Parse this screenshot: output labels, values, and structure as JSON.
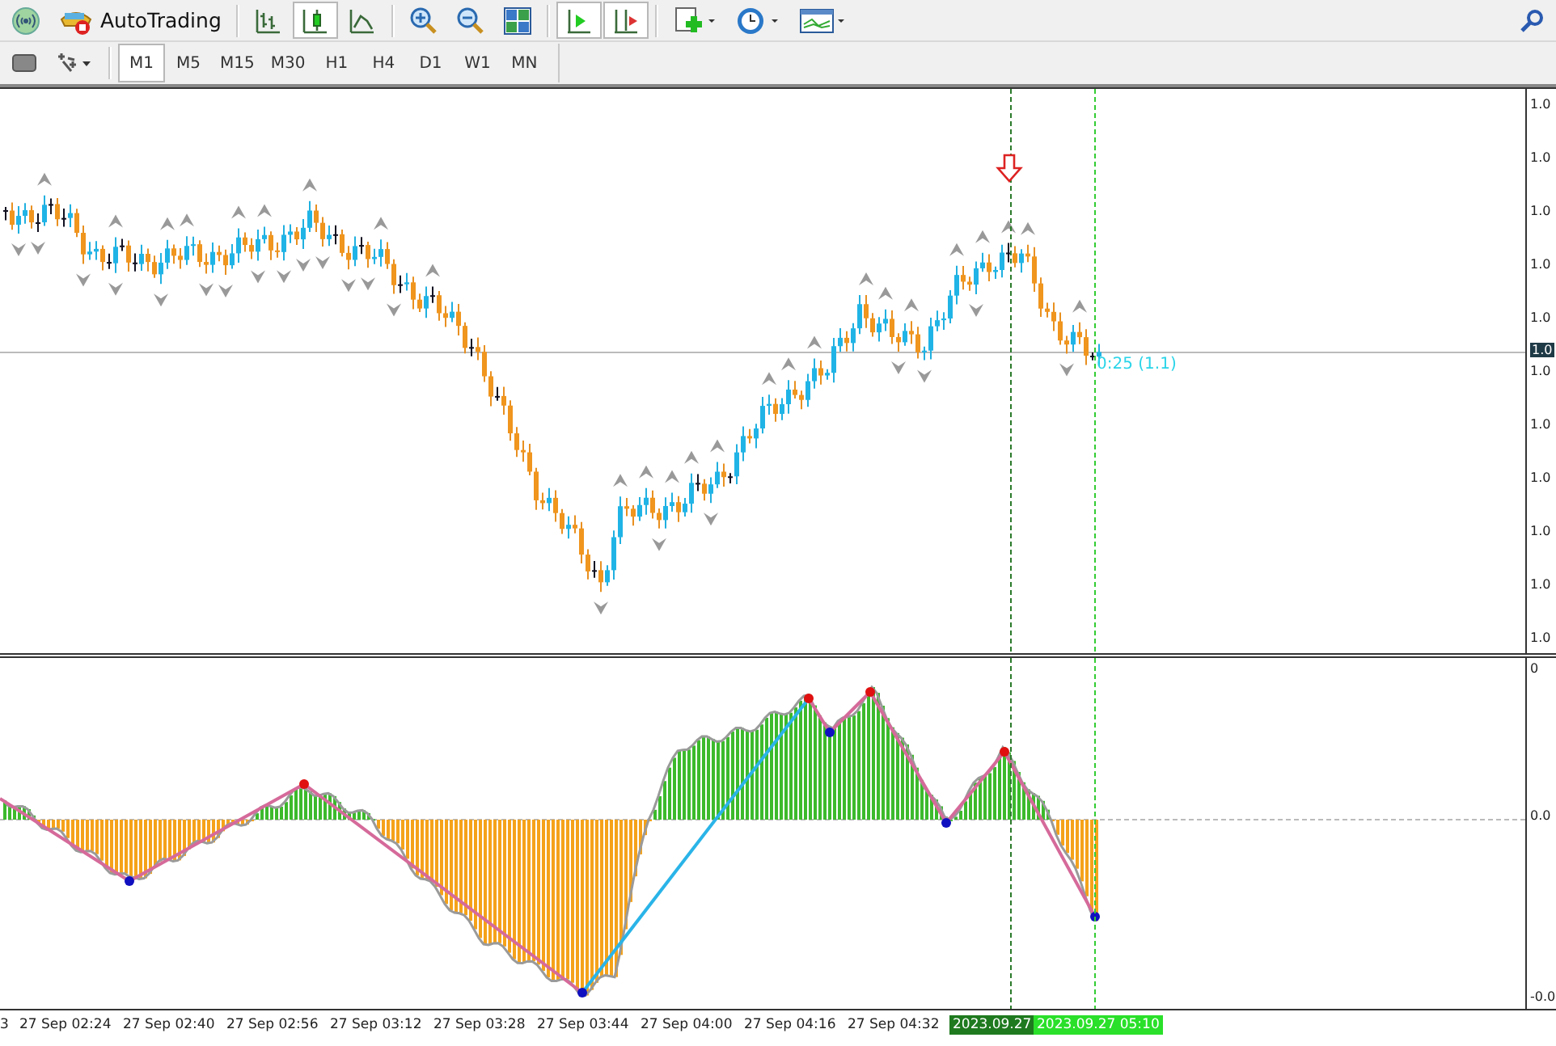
{
  "toolbar": {
    "autotrading": {
      "label": "AutoTrading",
      "on": false
    },
    "chart_types": [
      {
        "kind": "bars",
        "selected": false
      },
      {
        "kind": "candles",
        "selected": true
      },
      {
        "kind": "line",
        "selected": false
      }
    ],
    "toggles": [
      {
        "kind": "auto-scroll",
        "on": true
      },
      {
        "kind": "chart-shift",
        "on": true
      }
    ]
  },
  "timeframes": [
    {
      "label": "M1",
      "selected": true
    },
    {
      "label": "M5",
      "selected": false
    },
    {
      "label": "M15",
      "selected": false
    },
    {
      "label": "M30",
      "selected": false
    },
    {
      "label": "H1",
      "selected": false
    },
    {
      "label": "H4",
      "selected": false
    },
    {
      "label": "D1",
      "selected": false
    },
    {
      "label": "W1",
      "selected": false
    },
    {
      "label": "MN",
      "selected": false
    }
  ],
  "chart": {
    "countdown": "0:25 (1.1)",
    "current_price": "1.0",
    "price_labels": [
      "1.0",
      "1.0",
      "1.0",
      "1.0",
      "1.0",
      "1.0",
      "1.0",
      "1.0",
      "1.0",
      "1.0",
      "1.0"
    ]
  },
  "indicator": {
    "scale_labels": [
      "0",
      "0.0",
      "-0.0"
    ]
  },
  "time_axis": {
    "labels": [
      "3",
      "27 Sep 02:24",
      "27 Sep 02:40",
      "27 Sep 02:56",
      "27 Sep 03:12",
      "27 Sep 03:28",
      "27 Sep 03:44",
      "27 Sep 04:00",
      "27 Sep 04:16",
      "27 Sep 04:32"
    ],
    "crosshair_date": "2023.09.27",
    "current_time": "2023.09.27 05:10"
  }
}
